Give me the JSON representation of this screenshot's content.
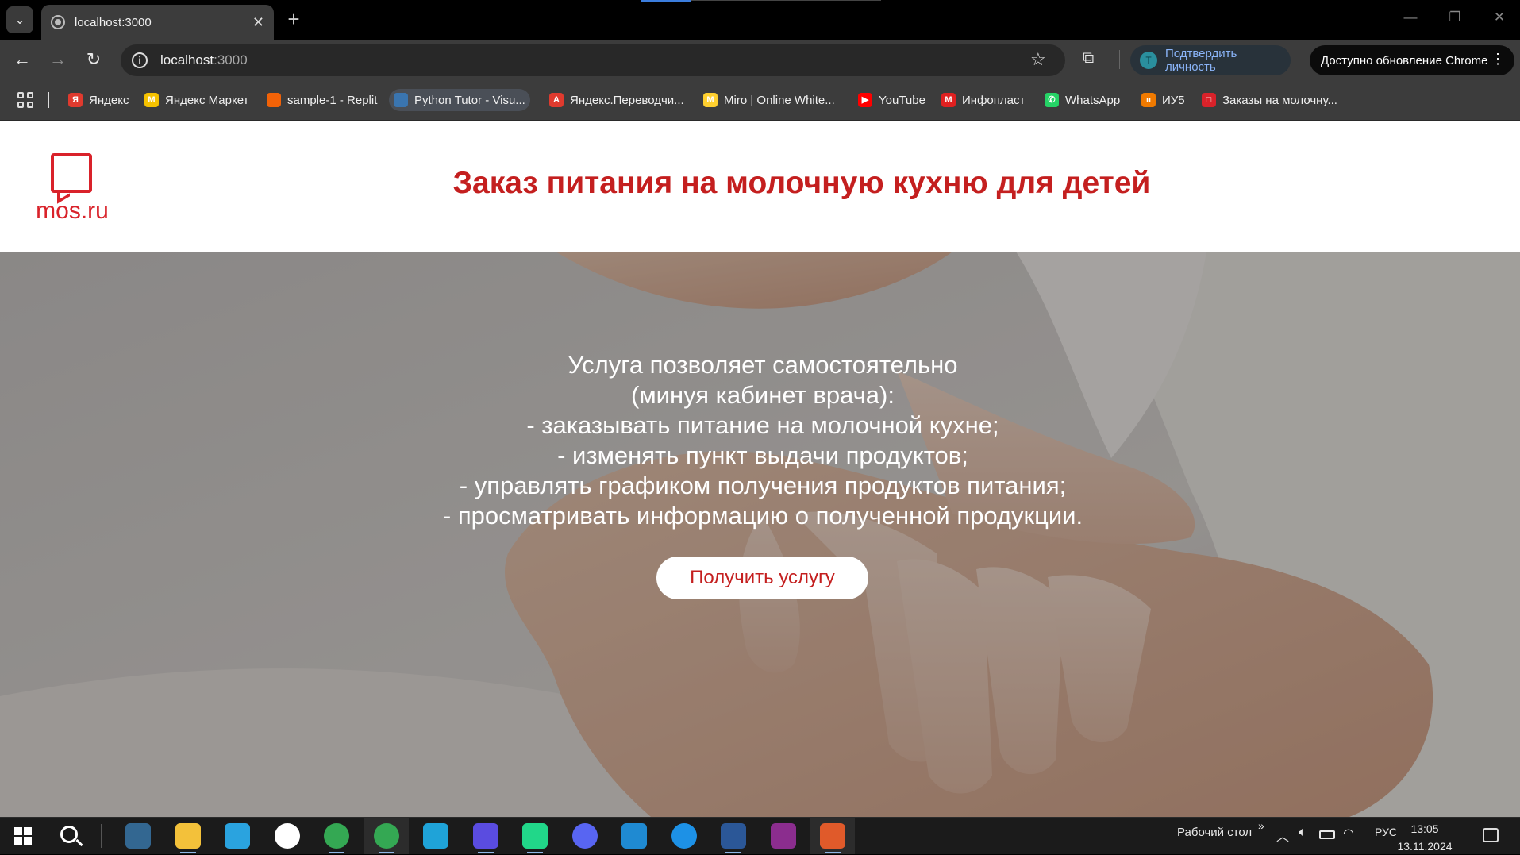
{
  "browser": {
    "tab_title": "localhost:3000",
    "tab_close": "✕",
    "new_tab": "+",
    "url_host": "localhost",
    "url_port": ":3000",
    "verify_label": "Подтвердить личность",
    "verify_avatar": "T",
    "update_label": "Доступно обновление Chrome",
    "bookmarks": [
      {
        "label": "Яндекс",
        "icon": "yandex-icon",
        "color": "#e03a2e",
        "glyph": "Я"
      },
      {
        "label": "Яндекс Маркет",
        "icon": "yandex-market-icon",
        "color": "#f6c200",
        "glyph": "M"
      },
      {
        "label": "sample-1 - Replit",
        "icon": "replit-icon",
        "color": "#f26207",
        "glyph": ""
      },
      {
        "label": "Python Tutor - Visu...",
        "icon": "python-icon",
        "color": "#3a75b0",
        "glyph": ""
      },
      {
        "label": "Яндекс.Переводчи...",
        "icon": "yandex-translate-icon",
        "color": "#e03a2e",
        "glyph": "A"
      },
      {
        "label": "Miro | Online White...",
        "icon": "miro-icon",
        "color": "#ffd02f",
        "glyph": "M"
      },
      {
        "label": "YouTube",
        "icon": "youtube-icon",
        "color": "#ff0000",
        "glyph": "▶"
      },
      {
        "label": "Инфопласт",
        "icon": "infoplast-icon",
        "color": "#e02020",
        "glyph": "M"
      },
      {
        "label": "WhatsApp",
        "icon": "whatsapp-icon",
        "color": "#25d366",
        "glyph": "✆"
      },
      {
        "label": "ИУ5",
        "icon": "iu5-icon",
        "color": "#f07a00",
        "glyph": "ıı"
      },
      {
        "label": "Заказы на молочну...",
        "icon": "orders-icon",
        "color": "#d9222a",
        "glyph": "□"
      }
    ]
  },
  "page": {
    "logo_text": "mos.ru",
    "title": "Заказ питания на молочную кухню для детей",
    "hero_lines": [
      "Услуга позволяет самостоятельно",
      "(минуя кабинет врача):",
      "- заказывать питание на молочной кухне;",
      "- изменять пункт выдачи продуктов;",
      "- управлять графиком получения продуктов питания;",
      "- просматривать информацию о полученной продукции."
    ],
    "cta_label": "Получить услугу"
  },
  "taskbar": {
    "desktop_label": "Рабочий стол",
    "chevrons": "»",
    "lang": "РУС",
    "time": "13:05",
    "date": "13.11.2024",
    "apps": [
      {
        "name": "postgres-icon",
        "color": "#336791"
      },
      {
        "name": "file-explorer-icon",
        "color": "#f3c13a"
      },
      {
        "name": "telegram-icon",
        "color": "#2aa3df"
      },
      {
        "name": "yandex-browser-icon",
        "color": "#ffffff"
      },
      {
        "name": "chrome-icon",
        "color": "#34a853"
      },
      {
        "name": "chrome-profile-icon",
        "color": "#34a853"
      },
      {
        "name": "edge-icon",
        "color": "#1fa3d8"
      },
      {
        "name": "goland-icon",
        "color": "#5a4ce0"
      },
      {
        "name": "pycharm-icon",
        "color": "#21d789"
      },
      {
        "name": "discord-icon",
        "color": "#5865f2"
      },
      {
        "name": "vscode-icon",
        "color": "#1f8ad2"
      },
      {
        "name": "docker-icon",
        "color": "#1d91e6"
      },
      {
        "name": "word-icon",
        "color": "#2b5797"
      },
      {
        "name": "winrar-icon",
        "color": "#8b2d8e"
      },
      {
        "name": "git-tool-icon",
        "color": "#e05a2a"
      }
    ]
  }
}
